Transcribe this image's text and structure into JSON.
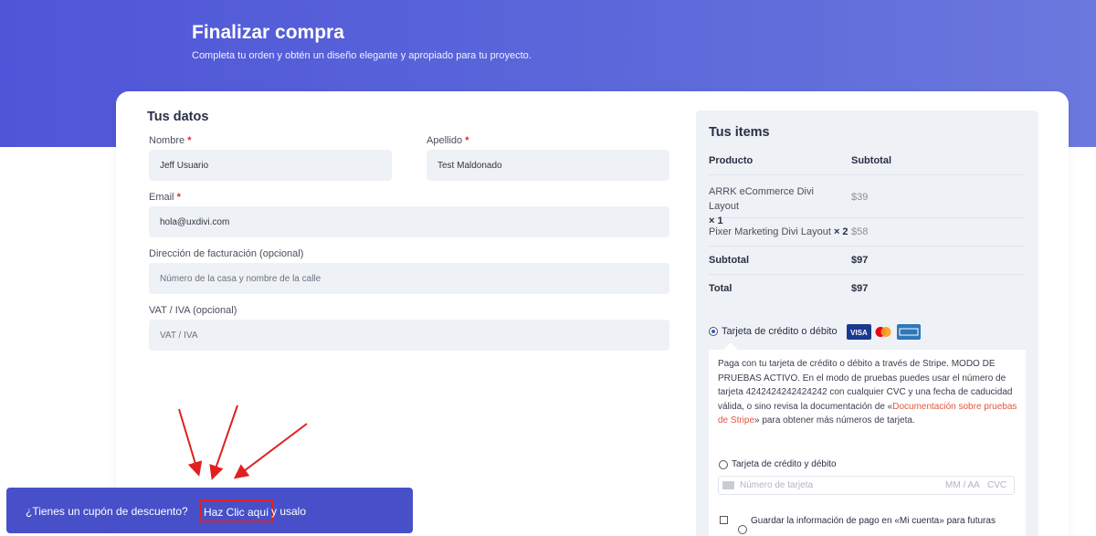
{
  "header": {
    "title": "Finalizar compra",
    "subtitle": "Completa tu orden y obtén un diseño elegante y apropiado para tu proyecto."
  },
  "billing": {
    "title": "Tus datos",
    "first_name": {
      "label": "Nombre",
      "value": "Jeff Usuario"
    },
    "last_name": {
      "label": "Apellido",
      "value": "Test Maldonado"
    },
    "email": {
      "label": "Email",
      "value": "hola@uxdivi.com"
    },
    "address": {
      "label": "Dirección de facturación (opcional)",
      "placeholder": "Número de la casa y nombre de la calle"
    },
    "vat": {
      "label": "VAT / IVA (opcional)",
      "placeholder": "VAT / IVA"
    },
    "required_mark": "*"
  },
  "order": {
    "title": "Tus items",
    "col_product": "Producto",
    "col_subtotal": "Subtotal",
    "items": [
      {
        "name": "ARRK eCommerce Divi Layout",
        "qty": "× 1",
        "price": "$39"
      },
      {
        "name": "Pixer Marketing Divi Layout",
        "qty": "× 2",
        "price": "$58"
      }
    ],
    "subtotal_label": "Subtotal",
    "subtotal_value": "$97",
    "total_label": "Total",
    "total_value": "$97"
  },
  "payment": {
    "method_label": "Tarjeta de crédito o débito",
    "card_brands": [
      "VISA",
      "Mastercard",
      "American Express"
    ],
    "description_prefix": "Paga con tu tarjeta de crédito o débito a través de Stripe. MODO DE PRUEBAS ACTIVO. En el modo de pruebas puedes usar el número de tarjeta 4242424242424242 con cualquier CVC y una fecha de caducidad válida, o sino revisa la documentación de «",
    "description_link": "Documentación sobre pruebas de Stripe",
    "description_suffix": "» para obtener más números de tarjeta.",
    "card_option_label": "Tarjeta de crédito y débito",
    "card_number_placeholder": "Número de tarjeta",
    "expiry_placeholder": "MM / AA",
    "cvc_placeholder": "CVC",
    "save_info_label": "Guardar la información de pago en «Mi cuenta» para futuras"
  },
  "coupon_banner": {
    "question": "¿Tienes un cupón de descuento?",
    "link": "Haz Clic aquí",
    "rest": "y usalo"
  },
  "colors": {
    "hero_start": "#4f55d8",
    "hero_end": "#6b78dd",
    "banner": "#4750c9",
    "required": "#d32f2f",
    "link": "#e0573e",
    "annotation": "#e02020"
  }
}
